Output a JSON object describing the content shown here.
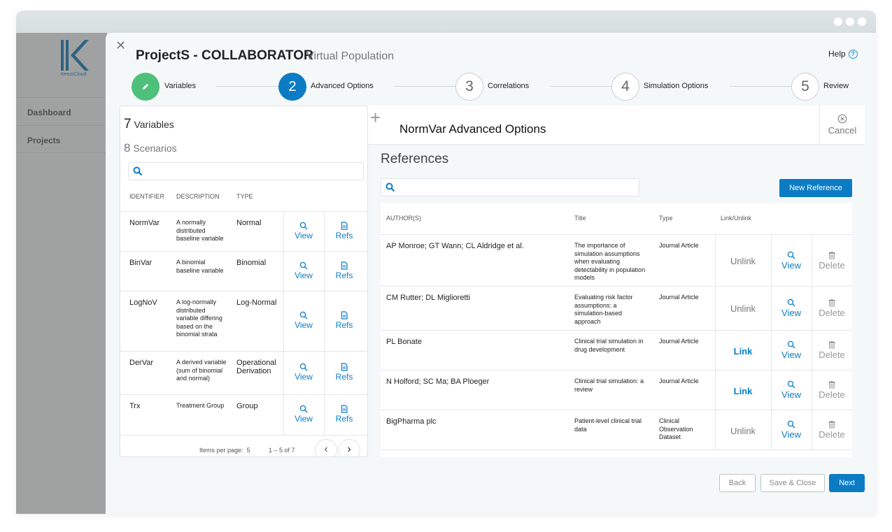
{
  "app": {
    "logo_text": "KerusCloud",
    "sidebar": [
      {
        "label": "Dashboard"
      },
      {
        "label": "Projects"
      }
    ]
  },
  "header": {
    "title": "ProjectS - COLLABORATOR",
    "subtitle": "Virtual Population",
    "help": "Help",
    "help_icon": "?"
  },
  "steps": [
    {
      "num": "",
      "label": "Variables",
      "state": "done"
    },
    {
      "num": "2",
      "label": "Advanced Options",
      "state": "active"
    },
    {
      "num": "3",
      "label": "Correlations",
      "state": "todo"
    },
    {
      "num": "4",
      "label": "Simulation Options",
      "state": "todo"
    },
    {
      "num": "5",
      "label": "Review",
      "state": "todo"
    }
  ],
  "left": {
    "var_num": "7",
    "var_label": "Variables",
    "scen_num": "8",
    "scen_label": "Scenarios",
    "search_placeholder": "",
    "headers": {
      "identifier": "IDENTIFIER",
      "description": "DESCRIPTION",
      "type": "TYPE"
    },
    "rows": [
      {
        "id": "NormVar",
        "desc": "A normally distributed baseline variable",
        "type": "Normal",
        "view": "View",
        "refs": "Refs"
      },
      {
        "id": "BinVar",
        "desc": "A binomial baseline variable",
        "type": "Binomial",
        "view": "View",
        "refs": "Refs"
      },
      {
        "id": "LogNoV",
        "desc": "A log-normally distributed variable differing based on the binomial strata",
        "type": "Log-Normal",
        "view": "View",
        "refs": "Refs"
      },
      {
        "id": "DerVar",
        "desc": "A derived variable (sum of binomial and normal)",
        "type": "Operational Derivation",
        "view": "View",
        "refs": "Refs"
      },
      {
        "id": "Trx",
        "desc": "Treatment Group",
        "type": "Group",
        "view": "View",
        "refs": "Refs"
      }
    ],
    "pager": {
      "items_label": "Items per page:",
      "items_value": "5",
      "range": "1 – 5 of 7",
      "prev": "‹",
      "next": "›"
    }
  },
  "right": {
    "title": "NormVar Advanced Options",
    "cancel": "Cancel",
    "plus": "+",
    "section_title": "References",
    "search_placeholder": "",
    "new_button": "New Reference",
    "headers": {
      "authors": "AUTHOR(S)",
      "title": "Title",
      "type": "Type",
      "link": "Link/Unlink"
    },
    "rows": [
      {
        "authors": "AP Monroe; GT Wann; CL Aldridge et al.",
        "title": "The importance of simulation assumptions when evaluating detectability in population models",
        "type": "Journal Article",
        "link": "Unlink",
        "link_state": "unlink",
        "view": "View",
        "delete": "Delete"
      },
      {
        "authors": "CM Rutter; DL Miglioretti",
        "title": "Evaluating risk factor assumptions: a simulation-based approach",
        "type": "Journal Article",
        "link": "Unlink",
        "link_state": "unlink",
        "view": "View",
        "delete": "Delete"
      },
      {
        "authors": "PL Bonate",
        "title": "Clinical trial simulation in drug development",
        "type": "Journal Article",
        "link": "Link",
        "link_state": "link",
        "view": "View",
        "delete": "Delete"
      },
      {
        "authors": "N Holford; SC Ma; BA Ploeger",
        "title": "Clinical trial simulation: a review",
        "type": "Journal Article",
        "link": "Link",
        "link_state": "link",
        "view": "View",
        "delete": "Delete"
      },
      {
        "authors": "BigPharma plc",
        "title": "Patient-level clinical trial data",
        "type": "Clinical Observation Dataset",
        "link": "Unlink",
        "link_state": "unlink",
        "view": "View",
        "delete": "Delete"
      }
    ]
  },
  "footer": {
    "back": "Back",
    "save_close": "Save & Close",
    "next": "Next"
  },
  "colors": {
    "primary": "#0b7cc4",
    "success": "#4ec07a",
    "muted": "#777777"
  },
  "icons": {
    "close": "close-icon",
    "pencil": "pencil-icon",
    "search": "search-icon",
    "view": "magnifier-icon",
    "refs": "document-icon",
    "delete": "trash-icon",
    "cancel": "cancel-circle-icon"
  }
}
